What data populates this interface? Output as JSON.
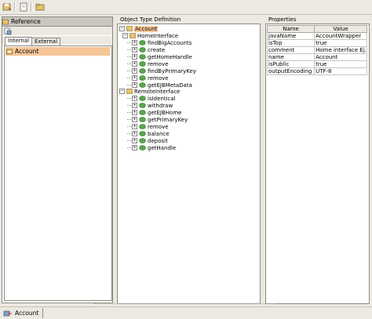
{
  "toolbar": {
    "icons": [
      "save-icon",
      "page-icon",
      "folder-icon"
    ]
  },
  "left": {
    "title": "Reference",
    "tabs": [
      {
        "label": "Internal",
        "active": true
      },
      {
        "label": "External",
        "active": false
      }
    ],
    "items": [
      {
        "label": "Account",
        "selected": true
      }
    ]
  },
  "middle": {
    "title": "Object Type Definition",
    "tree": {
      "root": "Account",
      "home_interface": "HomeInterface",
      "home_methods": [
        "findBigAccounts",
        "create",
        "getHomeHandle",
        "remove",
        "findByPrimaryKey",
        "remove",
        "getEJBMetaData"
      ],
      "remote_interface": "RemoteInterface",
      "remote_methods": [
        "isIdentical",
        "withdraw",
        "getEJBHome",
        "getPrimaryKey",
        "remove",
        "balance",
        "deposit",
        "getHandle"
      ]
    }
  },
  "right": {
    "title": "Properties",
    "columns": [
      "Name",
      "Value"
    ],
    "rows": [
      [
        "javaName",
        "AccountWrapper"
      ],
      [
        "isTop",
        "true"
      ],
      [
        "comment",
        "Home interface Ej..."
      ],
      [
        "name",
        "Account"
      ],
      [
        "isPublic",
        "true"
      ],
      [
        "outputEncoding",
        "UTF-8"
      ]
    ]
  },
  "bottom": {
    "tab_label": "Account"
  },
  "colors": {
    "selection": "#f6c596",
    "panel_bg": "#ece9e2"
  }
}
